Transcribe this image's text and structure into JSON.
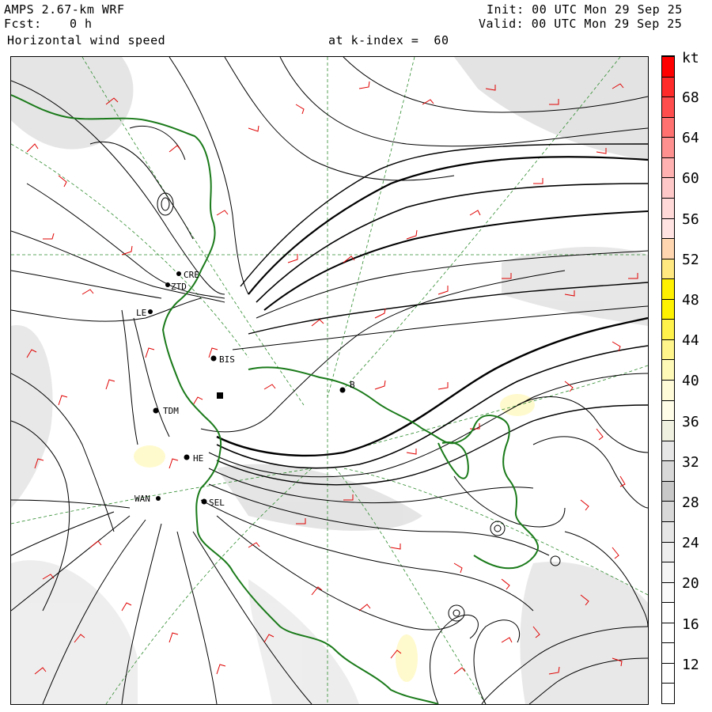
{
  "header": {
    "model": "AMPS 2.67-km WRF",
    "forecast_label": "Fcst:",
    "forecast_value": "0 h",
    "field": "Horizontal wind speed",
    "level": "at k-index =  60",
    "init": "Init: 00 UTC Mon 29 Sep 25",
    "valid": "Valid: 00 UTC Mon 29 Sep 25"
  },
  "colorbar": {
    "unit": "kt",
    "labels": [
      "68",
      "64",
      "60",
      "56",
      "52",
      "48",
      "44",
      "40",
      "36",
      "32",
      "28",
      "24",
      "20",
      "16",
      "12"
    ],
    "colors": [
      "#ff0000",
      "#ff2a2a",
      "#ff4d4d",
      "#ff7070",
      "#ff9090",
      "#ffb0b0",
      "#ffc8c8",
      "#ffd8d8",
      "#ffe2e2",
      "#ffd6b0",
      "#ffe880",
      "#fff000",
      "#fff200",
      "#fff24a",
      "#fff58a",
      "#fff9b8",
      "#fffbd8",
      "#fffde8",
      "#f0f0e0",
      "#e6e6e6",
      "#d8d8d8",
      "#c8c8c8",
      "#d8d8d8",
      "#e6e6e6",
      "#eeeeee",
      "#f5f5f5",
      "#fafafa",
      "#ffffff",
      "#ffffff",
      "#ffffff",
      "#ffffff",
      "#ffffff"
    ]
  },
  "stations": [
    {
      "code": "CRE"
    },
    {
      "code": "ZTD"
    },
    {
      "code": "LE"
    },
    {
      "code": "BIS"
    },
    {
      "code": "TDM"
    },
    {
      "code": "B"
    },
    {
      "code": "HE"
    },
    {
      "code": "SEL"
    },
    {
      "code": "WAN"
    }
  ]
}
